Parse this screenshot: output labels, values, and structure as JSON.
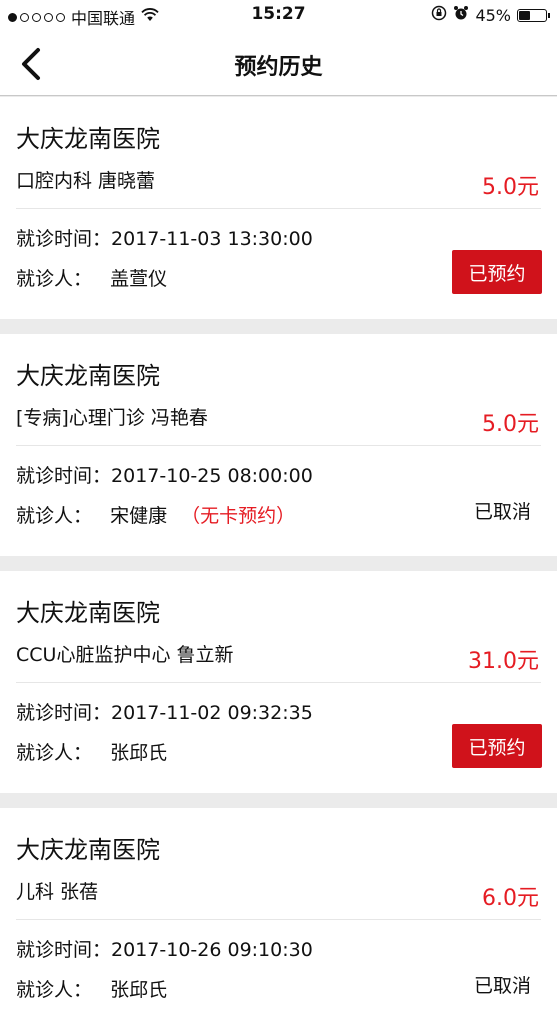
{
  "status_bar": {
    "carrier": "中国联通",
    "time": "15:27",
    "battery": "45%",
    "battery_level": 0.45
  },
  "nav": {
    "title": "预约历史"
  },
  "records": [
    {
      "hospital": "大庆龙南医院",
      "dept": "口腔内科   唐晓蕾",
      "price": "5.0元",
      "time_label": "就诊时间：",
      "time": "2017-11-03 13:30:00",
      "patient_label": "就诊人：",
      "patient": "盖萱仪",
      "note": "",
      "status": "已预约",
      "status_kind": "button"
    },
    {
      "hospital": "大庆龙南医院",
      "dept": "[专病]心理门诊   冯艳春",
      "price": "5.0元",
      "time_label": "就诊时间：",
      "time": "2017-10-25 08:00:00",
      "patient_label": "就诊人：",
      "patient": "宋健康",
      "note": "（无卡预约）",
      "status": "已取消",
      "status_kind": "text"
    },
    {
      "hospital": "大庆龙南医院",
      "dept": "CCU心脏监护中心   鲁立新",
      "price": "31.0元",
      "time_label": "就诊时间：",
      "time": "2017-11-02 09:32:35",
      "patient_label": "就诊人：",
      "patient": "张邱氏",
      "note": "",
      "status": "已预约",
      "status_kind": "button"
    },
    {
      "hospital": "大庆龙南医院",
      "dept": "儿科   张蓓",
      "price": "6.0元",
      "time_label": "就诊时间：",
      "time": "2017-10-26 09:10:30",
      "patient_label": "就诊人：",
      "patient": "张邱氏",
      "note": "",
      "status": "已取消",
      "status_kind": "text"
    }
  ],
  "colors": {
    "accent": "#d0121b",
    "price": "#e51c23",
    "page_bg": "#ebebeb"
  }
}
